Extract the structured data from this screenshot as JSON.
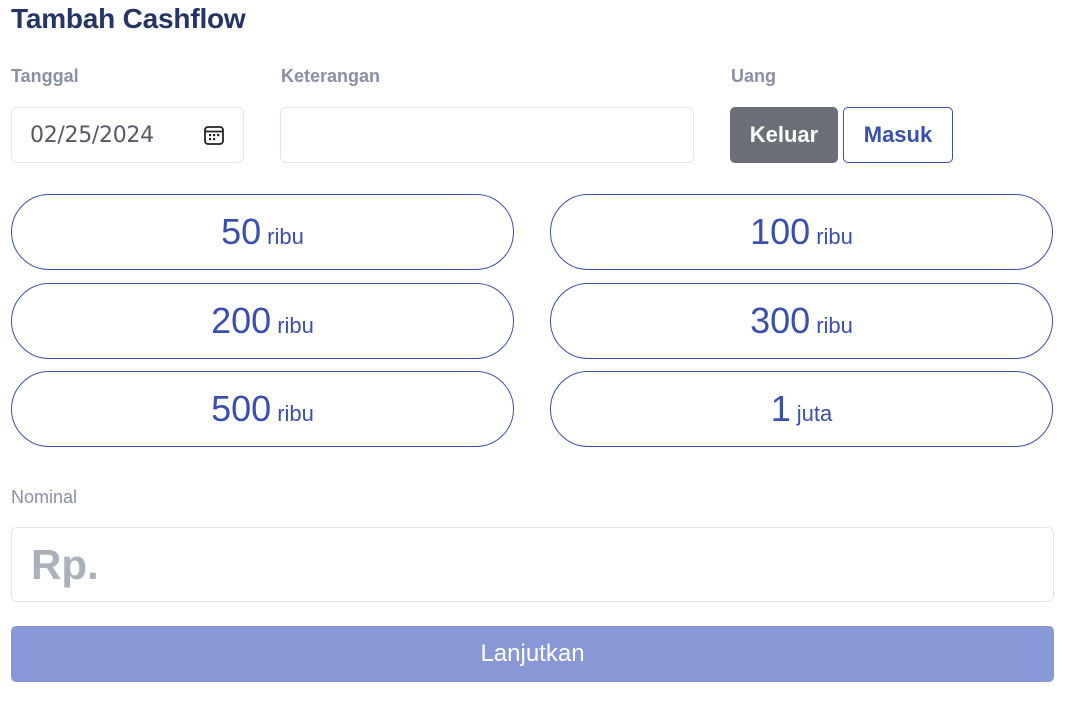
{
  "page": {
    "title": "Tambah Cashflow"
  },
  "form": {
    "tanggal": {
      "label": "Tanggal",
      "value": "02/25/2024",
      "icon": "calendar-icon"
    },
    "keterangan": {
      "label": "Keterangan",
      "value": ""
    },
    "uang": {
      "label": "Uang",
      "options": [
        "Keluar",
        "Masuk"
      ],
      "selected": "Keluar"
    },
    "presets": [
      {
        "amount": "50",
        "unit": "ribu"
      },
      {
        "amount": "100",
        "unit": "ribu"
      },
      {
        "amount": "200",
        "unit": "ribu"
      },
      {
        "amount": "300",
        "unit": "ribu"
      },
      {
        "amount": "500",
        "unit": "ribu"
      },
      {
        "amount": "1",
        "unit": "juta"
      }
    ],
    "nominal": {
      "label": "Nominal",
      "placeholder": "Rp.",
      "value": ""
    },
    "submit_label": "Lanjutkan"
  },
  "colors": {
    "title": "#233465",
    "accent": "#3a4fb0",
    "selected_toggle": "#6b7078",
    "submit_disabled": "#8897d5"
  }
}
